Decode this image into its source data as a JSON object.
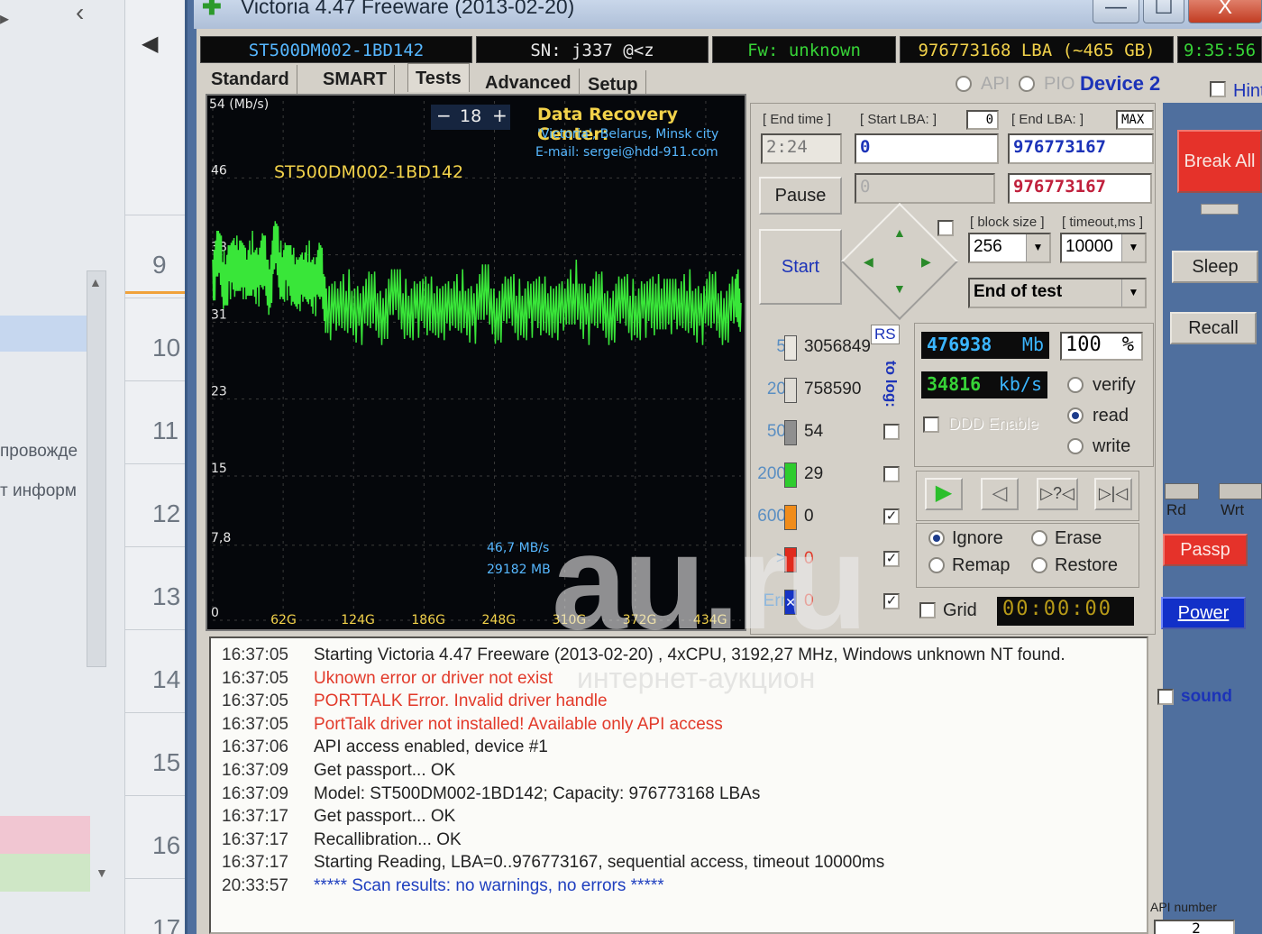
{
  "window": {
    "title": "Victoria 4.47  Freeware (2013-02-20)",
    "minimize": "—",
    "maximize": "☐",
    "close": "X"
  },
  "background": {
    "row_numbers": [
      "9",
      "10",
      "11",
      "12",
      "13",
      "14",
      "15",
      "16",
      "17"
    ],
    "cyr_text_1": "провожде",
    "cyr_text_2": "т информ",
    "nav_prev_left": "‹",
    "nav_prev": "◀"
  },
  "info_strip": {
    "model": "ST500DM002-1BD142",
    "sn": "SN: j337       @<z",
    "fw": "Fw: unknown",
    "lba": "976773168 LBA (~465 GB)",
    "clock": "9:35:56"
  },
  "tabs": [
    "Standard",
    "SMART",
    "Tests",
    "Advanced",
    "Setup"
  ],
  "mode": {
    "api": "API",
    "pio": "PIO",
    "device": "Device 2",
    "hint": "Hint"
  },
  "graph": {
    "y_unit": "54 (Mb/s)",
    "y_ticks": [
      "46",
      "38",
      "31",
      "23",
      "15",
      "7,8",
      "0"
    ],
    "x_ticks": [
      "62G",
      "124G",
      "186G",
      "248G",
      "310G",
      "372G",
      "434G"
    ],
    "zoom_minus": "−",
    "zoom_value": "18",
    "zoom_plus": "+",
    "model_label": "ST500DM002-1BD142",
    "drc_title": "Data Recovery Center:",
    "drc_line1": "'Victoria', Belarus, Minsk city",
    "drc_line2": "E-mail: sergei@hdd-911.com",
    "speed_readout": "46,7 MB/s",
    "mb_readout": "29182 MB"
  },
  "chart_data": {
    "type": "line",
    "ylabel": "(Mb/s)",
    "ylim": [
      0,
      54
    ],
    "xlim": [
      0,
      465
    ],
    "x_unit": "GB",
    "series": [
      {
        "values_description_note": "",
        "x": [
          0,
          5,
          10,
          15,
          20,
          25,
          30,
          35,
          40,
          45,
          50,
          55,
          60,
          65,
          70,
          75,
          80,
          85,
          90,
          95,
          100,
          110,
          120,
          130,
          140,
          150,
          160,
          170,
          180,
          190,
          200,
          210,
          220,
          230,
          240,
          250,
          260,
          270,
          280,
          290,
          300,
          310,
          320,
          330,
          340,
          350,
          360,
          370,
          380,
          390,
          400,
          410,
          420,
          430,
          440,
          450,
          460,
          465
        ],
        "y": [
          36,
          38,
          35,
          37,
          36,
          38,
          35,
          37,
          36,
          37,
          35,
          39,
          36,
          37,
          35,
          36,
          35,
          36,
          35,
          36,
          33,
          32,
          33,
          32,
          33,
          32,
          34,
          32,
          33,
          32,
          33,
          32,
          33,
          32,
          34,
          32,
          33,
          32,
          33,
          32,
          33,
          32,
          34,
          32,
          33,
          32,
          33,
          32,
          33,
          32,
          34,
          32,
          33,
          32,
          33,
          32,
          33,
          33
        ]
      }
    ]
  },
  "controls": {
    "end_time_label": "[ End time ]",
    "end_time_value": "2:24",
    "start_lba_label": "[ Start LBA: ]",
    "start_lba_zero": "0",
    "start_lba_value": "0",
    "start_lba_value2": "0",
    "end_lba_label": "[ End LBA: ]",
    "end_lba_max": "MAX",
    "end_lba_value": "976773167",
    "end_lba_value2": "976773167",
    "pause": "Pause",
    "start": "Start",
    "block_size_label": "[ block size ]",
    "block_size_value": "256",
    "timeout_label": "[ timeout,ms ]",
    "timeout_value": "10000",
    "end_action": "End of test"
  },
  "counters": {
    "rows": [
      {
        "label": "5",
        "value": "3056849",
        "color": "#e9e6df"
      },
      {
        "label": "20",
        "value": "758590",
        "color": "#dedbd4"
      },
      {
        "label": "50",
        "value": "54",
        "color": "#8f8f8f"
      },
      {
        "label": "200",
        "value": "29",
        "color": "#2ecc2e"
      },
      {
        "label": "600",
        "value": "0",
        "color": "#f08c1a"
      },
      {
        "label": ">",
        "value": "0",
        "color": "#e02a1d"
      },
      {
        "label": "Err",
        "value": "0",
        "color": "#1533c4"
      }
    ],
    "rs": "RS",
    "to_log": "to log:"
  },
  "stats": {
    "mb_value": "476938",
    "mb_unit": "Mb",
    "percent_value": "100",
    "percent_unit": "%",
    "speed_value": "34816",
    "speed_unit": "kb/s",
    "ddd": "DDD Enable",
    "verify": "verify",
    "read": "read",
    "write": "write",
    "selected_mode": "read"
  },
  "action": {
    "ignore": "Ignore",
    "erase": "Erase",
    "remap": "Remap",
    "restore": "Restore",
    "selected": "Ignore",
    "grid": "Grid",
    "timer": "00:00:00"
  },
  "right_panel": {
    "break_all": "Break All",
    "sleep": "Sleep",
    "recall": "Recall",
    "rd": "Rd",
    "wrt": "Wrt",
    "passp": "Passp",
    "power": "Power",
    "sound": "sound",
    "api_number": "API number",
    "api_value": "2"
  },
  "log": [
    {
      "time": "16:37:05",
      "text": "Starting Victoria 4.47  Freeware (2013-02-20) , 4xCPU, 3192,27 MHz, Windows unknown NT found.",
      "color": "#222222"
    },
    {
      "time": "16:37:05",
      "text": "Uknown error or driver not exist",
      "color": "#e23a2a"
    },
    {
      "time": "16:37:05",
      "text": "PORTTALK Error. Invalid driver handle",
      "color": "#e23a2a"
    },
    {
      "time": "16:37:05",
      "text": "PortTalk driver not installed! Available only API access",
      "color": "#e23a2a"
    },
    {
      "time": "16:37:06",
      "text": "API access enabled, device #1",
      "color": "#222222"
    },
    {
      "time": "16:37:09",
      "text": "Get passport... OK",
      "color": "#222222"
    },
    {
      "time": "16:37:09",
      "text": "Model: ST500DM002-1BD142; Capacity: 976773168 LBAs",
      "color": "#222222"
    },
    {
      "time": "16:37:17",
      "text": "Get passport... OK",
      "color": "#222222"
    },
    {
      "time": "16:37:17",
      "text": "Recallibration... OK",
      "color": "#222222"
    },
    {
      "time": "16:37:17",
      "text": "Starting Reading, LBA=0..976773167, sequential access, timeout 10000ms",
      "color": "#222222"
    },
    {
      "time": "20:33:57",
      "text": "***** Scan results: no warnings, no errors *****",
      "color": "#1f3fbf"
    }
  ],
  "watermark": {
    "big": "au.ru",
    "sub": "интернет-аукцион"
  }
}
